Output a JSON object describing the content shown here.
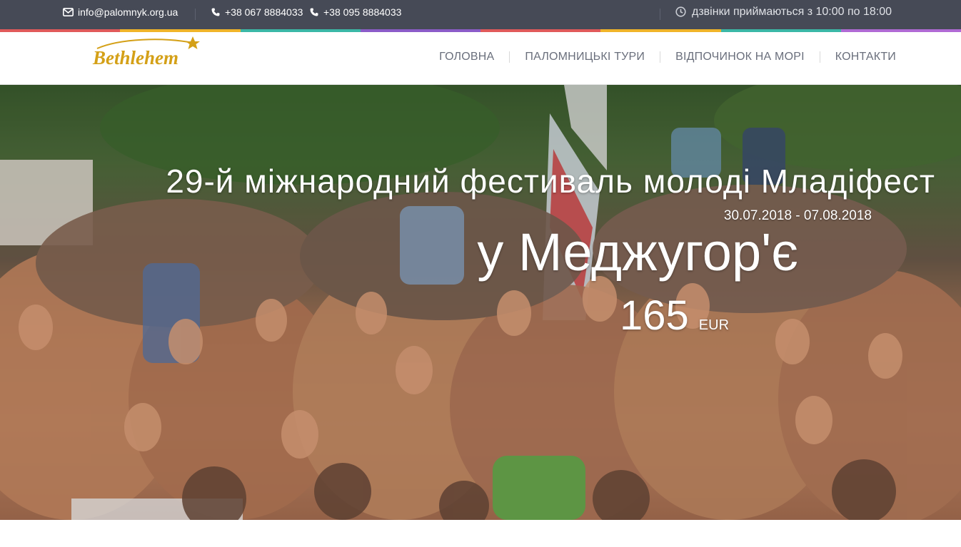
{
  "topbar": {
    "email": "info@palomnyk.org.ua",
    "phone1": "+38 067 8884033",
    "phone2": "+38 095 8884033",
    "hours": "дзвінки приймаються з 10:00 по 18:00",
    "icons": [
      "envelope-icon",
      "phone-icon",
      "clock-icon"
    ]
  },
  "brand": {
    "logo_text": "Bethlehem",
    "color": "#d4a017"
  },
  "nav": {
    "items": [
      {
        "label": "ГОЛОВНА"
      },
      {
        "label": "ПАЛОМНИЦЬКІ ТУРИ"
      },
      {
        "label": "ВІДПОЧИНОК НА МОРІ"
      },
      {
        "label": "КОНТАКТИ"
      }
    ]
  },
  "hero": {
    "title": "29-й міжнародний фестиваль молоді Младіфест",
    "dates": "30.07.2018 - 07.08.2018",
    "place": "у Меджугор'є",
    "price": "165",
    "currency": "EUR"
  },
  "colors": {
    "topbar_bg": "#464a56",
    "nav_text": "#6a6f7c",
    "stripe": [
      "#e05a5a",
      "#f0b429",
      "#3bb7a6",
      "#8b5cc8",
      "#e05a5a",
      "#f0b429",
      "#3bb7a6",
      "#b06ad4"
    ]
  }
}
